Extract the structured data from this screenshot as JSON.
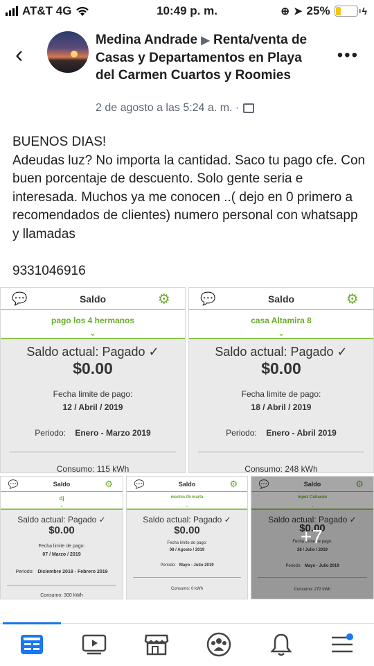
{
  "status": {
    "carrier": "AT&T 4G",
    "time": "10:49 p. m.",
    "battery": "25%"
  },
  "post": {
    "author": "Medina Andrade",
    "group": "Renta/venta de Casas y Departamentos en Playa del Carmen Cuartos y Roomies",
    "date": "2 de agosto a las 5:24 a. m. ·",
    "body": "BUENOS DIAS!\nAdeudas luz? No importa la cantidad. Saco tu pago cfe. Con buen  porcentaje de descuento. Solo gente seria e interesada. Muchos ya me conocen ..( dejo en 0 primero a recomendados de clientes) numero personal con whatsapp y llamadas\n\n9331046916"
  },
  "cards": [
    {
      "title": "Saldo",
      "account": "pago los 4 hermanos",
      "saldo_label": "Saldo actual:  Pagado",
      "amount": "$0.00",
      "fecha_label": "Fecha limite de pago:",
      "fecha": "12 / Abril / 2019",
      "periodo_label": "Periodo:",
      "periodo": "Enero - Marzo 2019",
      "consumo": "Consumo: 115 kWh"
    },
    {
      "title": "Saldo",
      "account": "casa Altamira 8",
      "saldo_label": "Saldo actual:  Pagado",
      "amount": "$0.00",
      "fecha_label": "Fecha limite de pago:",
      "fecha": "18 / Abril / 2019",
      "periodo_label": "Periodo:",
      "periodo": "Enero - Abril 2019",
      "consumo": "Consumo: 248 kWh"
    },
    {
      "title": "Saldo",
      "account": "dj",
      "saldo_label": "Saldo actual:  Pagado",
      "amount": "$0.00",
      "fecha_label": "Fecha limite de pago:",
      "fecha": "07 / Marzo / 2019",
      "periodo_label": "Periodo:",
      "periodo": "Diciembre 2018 - Febrero 2019",
      "consumo": "Consumo: 300 kWh"
    },
    {
      "title": "Saldo",
      "account": "mechis 05 marta",
      "saldo_label": "Saldo actual:  Pagado",
      "amount": "$0.00",
      "fecha_label": "Fecha limite de pago:",
      "fecha": "08 / Agosto / 2019",
      "periodo_label": "Periodo:",
      "periodo": "Mayo - Julio 2019",
      "consumo": "Consumo: 0 kWh"
    },
    {
      "title": "Saldo",
      "account": "lopez Culiacán",
      "saldo_label": "Saldo actual:  Pagado",
      "amount": "$0.00",
      "fecha_label": "Fecha limite de pago:",
      "fecha": "28 / Julio / 2019",
      "periodo_label": "Periodo:",
      "periodo": "Mayo - Julio 2019",
      "consumo": "Consumo: 272 kWh"
    }
  ],
  "more_photos": "+7",
  "nav": {
    "items": [
      "news-feed-icon",
      "watch-icon",
      "marketplace-icon",
      "groups-icon",
      "notifications-icon",
      "menu-icon"
    ]
  },
  "colors": {
    "accent": "#1877f2",
    "app_green": "#6aab2e"
  }
}
